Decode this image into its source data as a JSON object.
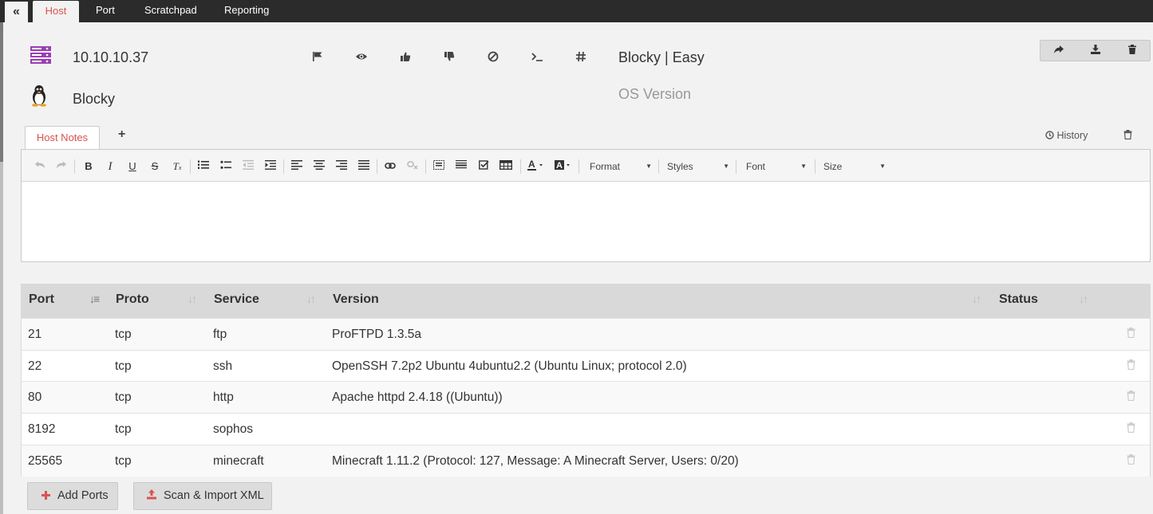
{
  "nav": {
    "collapse_label": "«",
    "tabs": [
      {
        "label": "Host"
      },
      {
        "label": "Port"
      },
      {
        "label": "Scratchpad"
      },
      {
        "label": "Reporting"
      }
    ]
  },
  "host": {
    "ip": "10.10.10.37",
    "hostname": "Blocky",
    "title": "Blocky | Easy",
    "os_version_placeholder": "OS Version",
    "icons": [
      "server-icon",
      "linux-penguin-icon"
    ]
  },
  "status_icons": [
    "flag-icon",
    "eye-icon",
    "thumbs-up-icon",
    "thumbs-down-icon",
    "ban-icon",
    "terminal-icon",
    "hash-icon"
  ],
  "top_buttons": [
    "share-icon",
    "download-icon",
    "trash-icon"
  ],
  "notes": {
    "tab_label": "Host Notes",
    "add_label": "+",
    "history_label": "History"
  },
  "editor_toolbar": {
    "format_label": "Format",
    "styles_label": "Styles",
    "font_label": "Font",
    "size_label": "Size"
  },
  "ports_table": {
    "headers": [
      "Port",
      "Proto",
      "Service",
      "Version",
      "Status"
    ],
    "rows": [
      {
        "port": "21",
        "proto": "tcp",
        "service": "ftp",
        "version": "ProFTPD 1.3.5a",
        "status": ""
      },
      {
        "port": "22",
        "proto": "tcp",
        "service": "ssh",
        "version": "OpenSSH 7.2p2 Ubuntu 4ubuntu2.2 (Ubuntu Linux; protocol 2.0)",
        "status": ""
      },
      {
        "port": "80",
        "proto": "tcp",
        "service": "http",
        "version": "Apache httpd 2.4.18 ((Ubuntu))",
        "status": ""
      },
      {
        "port": "8192",
        "proto": "tcp",
        "service": "sophos",
        "version": "",
        "status": ""
      },
      {
        "port": "25565",
        "proto": "tcp",
        "service": "minecraft",
        "version": "Minecraft 1.11.2 (Protocol: 127, Message: A Minecraft Server, Users: 0/20)",
        "status": ""
      }
    ]
  },
  "buttons": {
    "add_ports": "Add Ports",
    "scan_import": "Scan & Import XML"
  },
  "colors": {
    "accent": "#d9534f",
    "server_icon": "#9b3fb5",
    "nav_bg": "#2b2b2b"
  }
}
